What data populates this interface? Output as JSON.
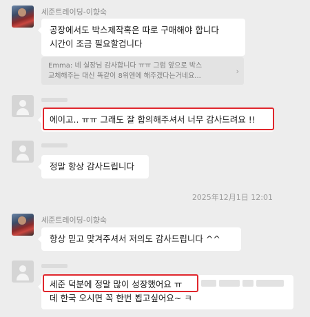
{
  "messages": [
    {
      "sender": "세준트레이딩-이향숙",
      "lines": [
        "공장에서도 박스제작혹은 따로 구매해야 합니다",
        "시간이 조금 필요할겁니다"
      ]
    },
    {
      "quote_lines": [
        "Emma: 네 실장님 감사합니다 ㅠㅠ 그럼 앞으로 박스",
        "교체해주는 대신 똑같이 8위엔에 해주겠다는거네요..."
      ],
      "quote_chevron": "›"
    },
    {
      "text": "에이고.. ㅠㅠ 그래도 잘 합의해주셔서 너무 감사드려요 !!"
    },
    {
      "text": "정말 항상 감사드립니다"
    },
    {
      "timestamp": "2025年12月1日 12:01"
    },
    {
      "sender": "세준트레이딩-이향숙",
      "text": "항상 믿고 맞겨주셔서 저의도 감사드립니다 ^^"
    },
    {
      "line1": "세준 덕분에 정말 많이 성장했어요 ㅠ",
      "line2": "데 한국 오시면 꼭 한번 뵙고싶어요~ ㅋ"
    }
  ],
  "colors": {
    "background": "#ededed",
    "bubble": "#ffffff",
    "highlight": "#e0262c",
    "quote": "#e3e3e3"
  }
}
